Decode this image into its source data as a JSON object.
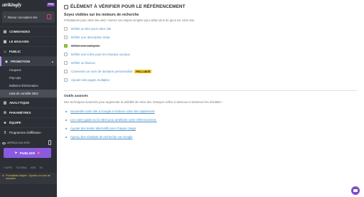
{
  "sidebar": {
    "logo": "strikingly",
    "pro_badge": "PRO",
    "return_label": "Retour conception site",
    "nav": [
      {
        "label": "COMMANDES",
        "icon": "orders-icon"
      },
      {
        "label": "LE MAGASIN",
        "icon": "store-icon"
      },
      {
        "label": "PUBLIC",
        "icon": "people-icon"
      },
      {
        "label": "PROMOTION",
        "icon": "megaphone-icon"
      },
      {
        "label": "ANALYTIQUE",
        "icon": "chart-icon"
      },
      {
        "label": "PARAMÈTRES",
        "icon": "gear-icon"
      },
      {
        "label": "ÉQUIPE",
        "icon": "team-icon"
      }
    ],
    "promotion_sub": [
      "Coupons",
      "Pop-Ups",
      "Bulletins d'information",
      "Liste de contrôle SEO"
    ],
    "affiliate": "Programme d'affiliation",
    "apercu": "APERÇU DU SITE",
    "publish": "PUBLIER",
    "publish_count": "1",
    "footer_links": [
      "+ CARTE",
      "TUTORIAL",
      "AIDE",
      "ES"
    ],
    "next_step": "Prochaines étapes : Ajoutez un nom de domaine"
  },
  "main": {
    "section_title": "ÉLÉMENT À VÉRIFIER POUR LE RÉFÉRENCEMENT",
    "seo_subtitle": "Soyez visibles sur les moteurs de recherche",
    "seo_desc": "Félicitations pour votre site web ! Suivez ces étapes simples pour attirer plus de gens sur votre site.",
    "checklist": [
      {
        "label": "Définir un titre pour votre site",
        "done": false
      },
      {
        "label": "Définir une description insta",
        "done": false
      },
      {
        "label": "Définir une catégorie",
        "done": true
      },
      {
        "label": "Définir une icône pour les réseaux sociaux",
        "done": false
      },
      {
        "label": "Définir un favicon",
        "done": false
      },
      {
        "label": "Connecter un nom de domaine personnalisé",
        "done": false,
        "tag": "PRO | LIMITÉ"
      },
      {
        "label": "Ajouter des pages multiples",
        "done": false
      }
    ],
    "advanced_title": "Outils avancés",
    "advanced_desc": "Des techniques avancées pour augmenter la visibilité de votre site. Essayez celles ci-dessous et observez les résultats !",
    "advanced_links": [
      "Soumettre votre site à Google et indexer votre site rapidement",
      "Lire notre guide sur la SEO pour améliorer votre référencement.",
      "Ajouter des textes alternatifs pour chaque image",
      "Aperçu des résultats de recherche sur Google"
    ]
  },
  "colors": {
    "sidebar_bg": "#2c2f35",
    "accent": "#8a5ae0",
    "link": "#4a90c8",
    "check": "#7cb82f"
  }
}
